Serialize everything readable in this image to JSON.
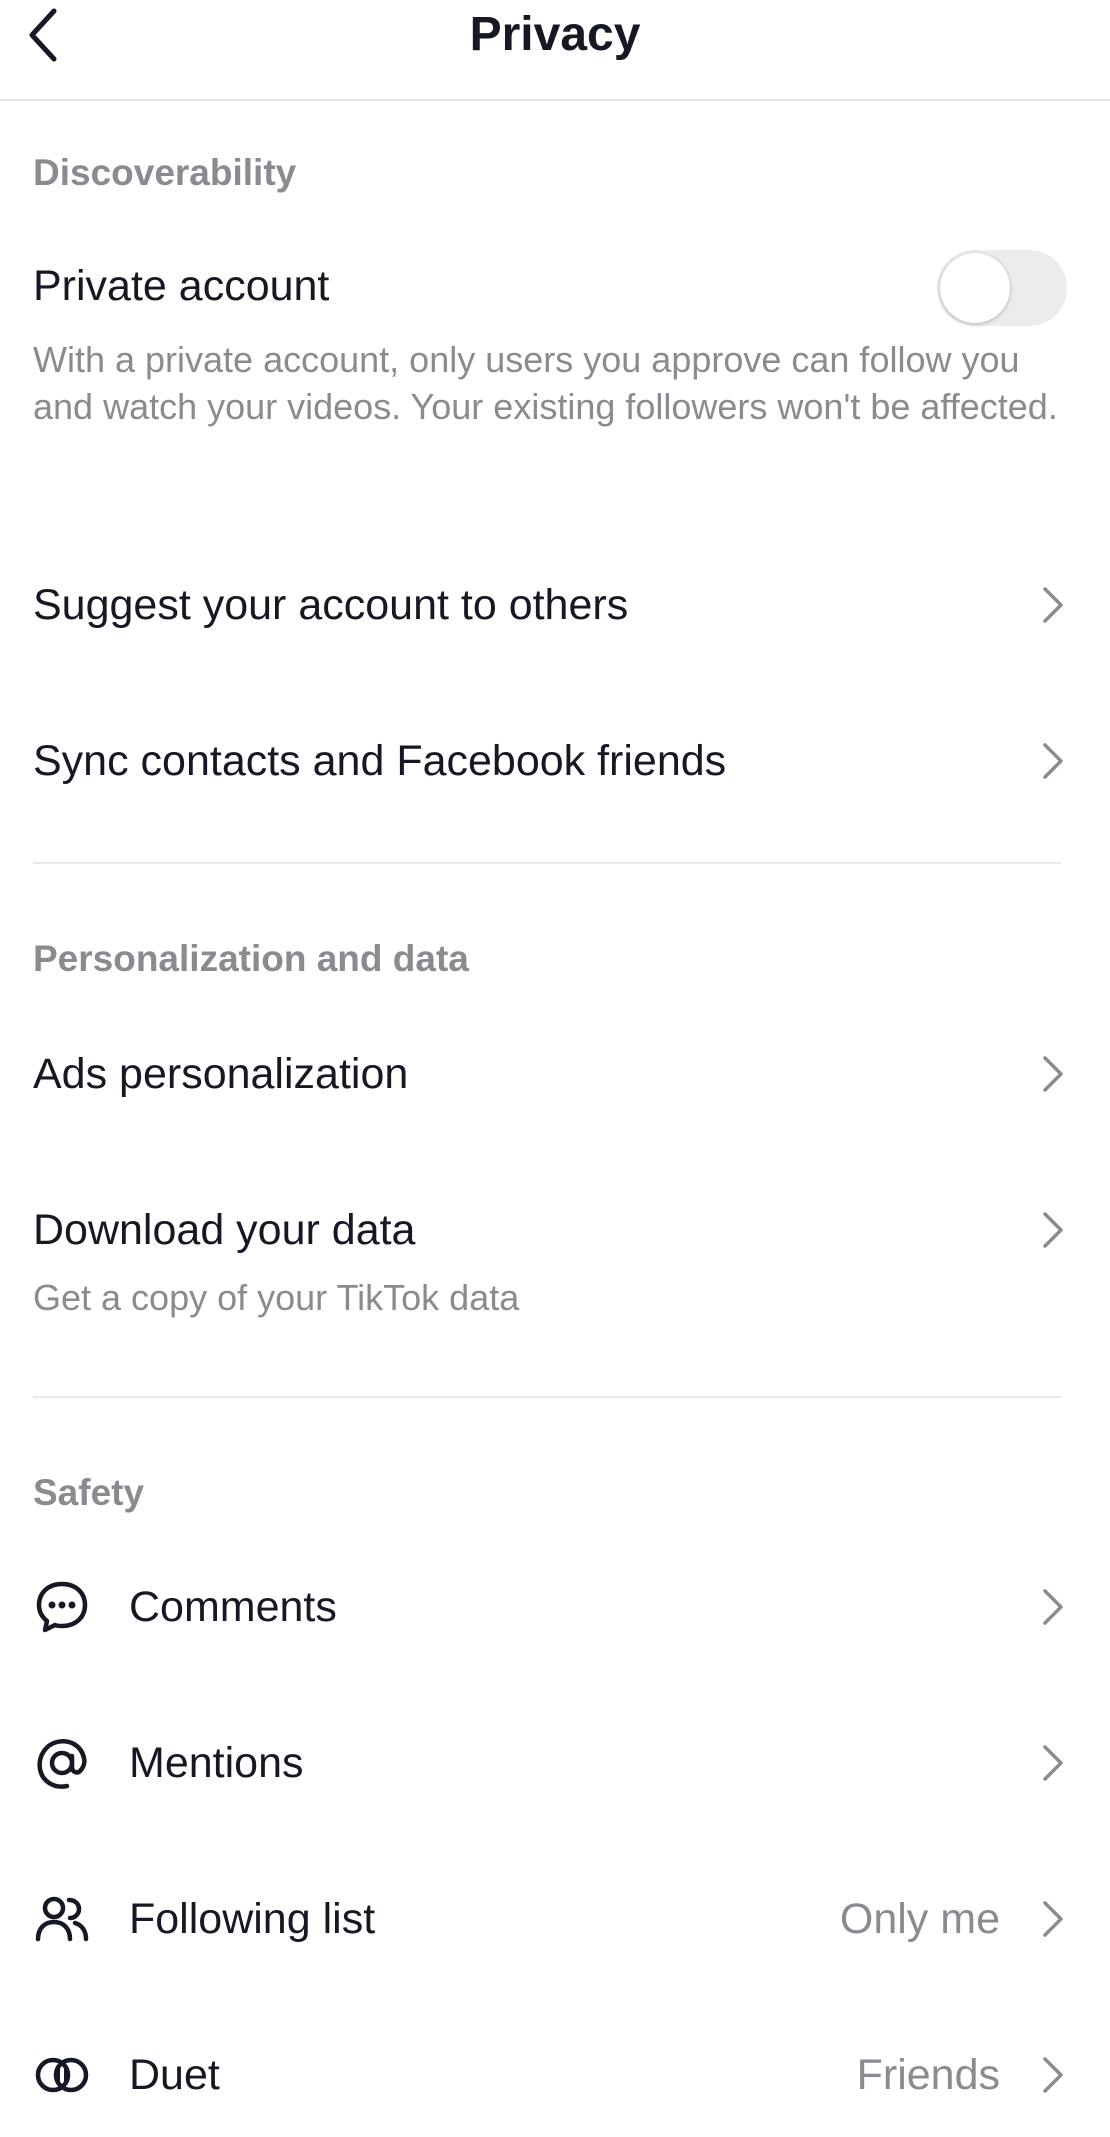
{
  "header": {
    "title": "Privacy",
    "back_icon": "chevron-left-icon"
  },
  "discoverability": {
    "title": "Discoverability",
    "private_account": {
      "label": "Private account",
      "toggle_on": false,
      "description": "With a private account, only users you approve can follow you and watch your videos. Your existing followers won't be affected."
    },
    "suggest": {
      "label": "Suggest your account to others"
    },
    "sync": {
      "label": "Sync contacts and Facebook friends"
    }
  },
  "personalization": {
    "title": "Personalization and data",
    "ads": {
      "label": "Ads personalization"
    },
    "download": {
      "label": "Download your data",
      "sub": "Get a copy of your TikTok data"
    }
  },
  "safety": {
    "title": "Safety",
    "items": [
      {
        "label": "Comments",
        "icon": "comment-bubble-icon",
        "value": ""
      },
      {
        "label": "Mentions",
        "icon": "at-sign-icon",
        "value": ""
      },
      {
        "label": "Following list",
        "icon": "people-icon",
        "value": "Only me"
      },
      {
        "label": "Duet",
        "icon": "duet-icon",
        "value": "Friends"
      }
    ]
  },
  "colors": {
    "text_primary": "#161823",
    "text_secondary": "#8a8b91",
    "divider": "#e8e8e9",
    "toggle_off": "#ececed"
  }
}
